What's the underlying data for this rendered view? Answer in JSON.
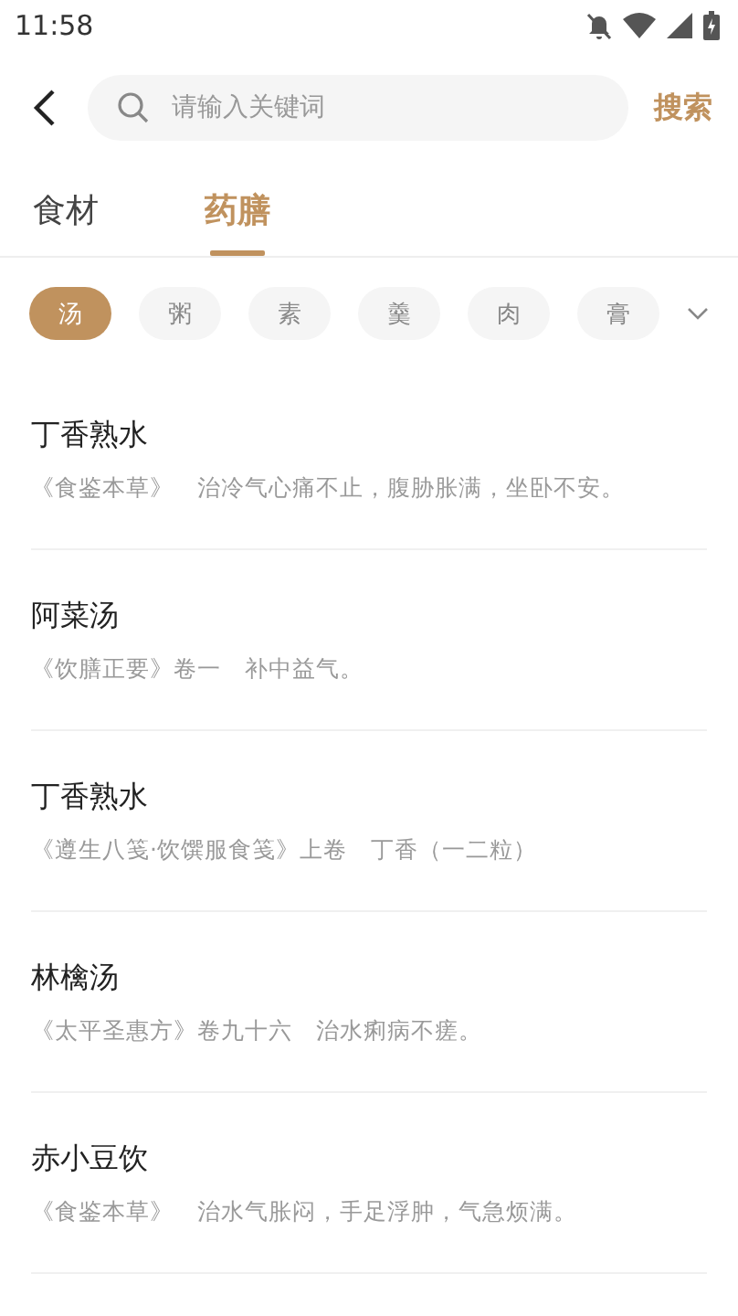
{
  "status_bar": {
    "time": "11:58"
  },
  "search": {
    "placeholder": "请输入关键词",
    "button": "搜索"
  },
  "tabs": [
    {
      "label": "食材",
      "selected": false
    },
    {
      "label": "药膳",
      "selected": true
    }
  ],
  "chips": [
    {
      "label": "汤",
      "selected": true
    },
    {
      "label": "粥",
      "selected": false
    },
    {
      "label": "素",
      "selected": false
    },
    {
      "label": "羹",
      "selected": false
    },
    {
      "label": "肉",
      "selected": false
    },
    {
      "label": "膏",
      "selected": false
    }
  ],
  "items": [
    {
      "title": "丁香熟水",
      "source": "《食鉴本草》　治冷气心痛不止，腹胁胀满，坐卧不安。"
    },
    {
      "title": "阿菜汤",
      "source": "《饮膳正要》卷一　补中益气。"
    },
    {
      "title": "丁香熟水",
      "source": "《遵生八笺·饮馔服食笺》上卷　丁香（一二粒）"
    },
    {
      "title": "林檎汤",
      "source": "《太平圣惠方》卷九十六　治水痢病不瘥。"
    },
    {
      "title": "赤小豆饮",
      "source": "《食鉴本草》　治水气胀闷，手足浮肿，气急烦满。"
    }
  ]
}
